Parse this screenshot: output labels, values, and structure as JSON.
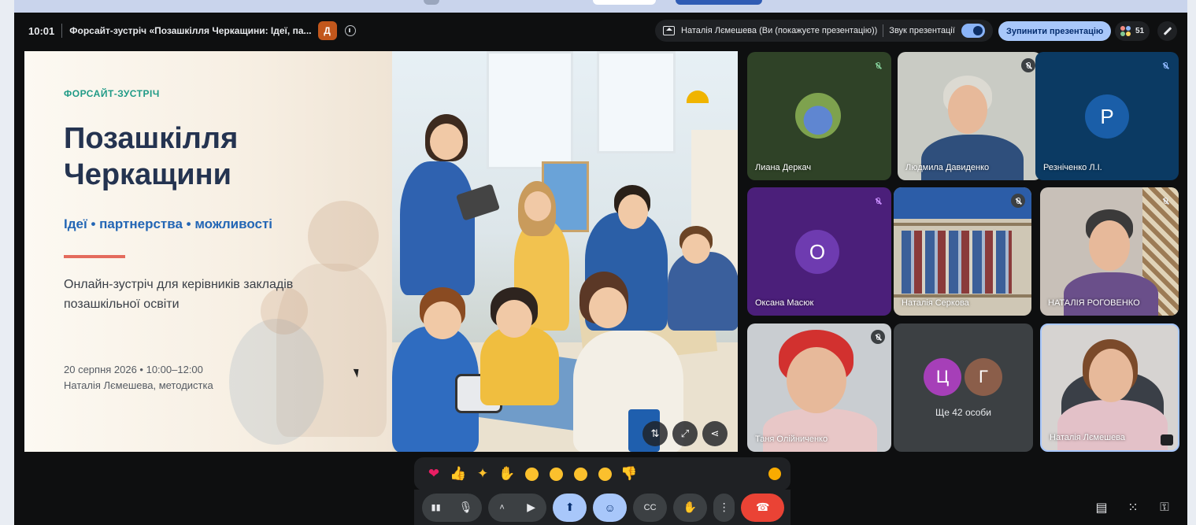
{
  "topbar": {
    "time": "10:01",
    "meeting_title": "Форсайт-зустріч «Позашкілля Черкащини: Ідеї, па...",
    "badge_letter": "Д",
    "presenting_label": "Наталія Лємешева (Ви (покажуєте презентацію))",
    "presentation_sound_label": "Звук презентації",
    "stop_presenting_label": "Зупинити презентацію",
    "participants_count": "51"
  },
  "slide": {
    "kicker": "ФОРСАЙТ-ЗУСТРІЧ",
    "title": "Позашкілля Черкащини",
    "subtitle": "Ідеї • партнерства • можливості",
    "description": "Онлайн-зустріч для керівників закладів позашкільної освіти",
    "date_line": "20 серпня 2026 • 10:00–12:00",
    "author_line": "Наталія Лємешева, методистка"
  },
  "participants": [
    {
      "name": "Лиана Деркач",
      "muted": true,
      "bg": "#2f4227"
    },
    {
      "name": "Людмила Давиденко",
      "muted": true,
      "bg": "#c9cbc4"
    },
    {
      "name": "Резніченко Л.І.",
      "muted": true,
      "bg": "#0b3a63",
      "initial": "Р",
      "avatar_color": "#1a5ea8"
    },
    {
      "name": "Оксана Масюк",
      "muted": true,
      "bg": "#4b1f7a",
      "initial": "О",
      "avatar_color": "#6e3bb0"
    },
    {
      "name": "Наталія Серкова",
      "muted": true,
      "bg": "#cfc7b5"
    },
    {
      "name": "НАТАЛІЯ РОГОВЕНКО",
      "muted": true,
      "bg": "#c8c0b8"
    },
    {
      "name": "Таня Олійниченко",
      "muted": true,
      "bg": "#c9cdd1"
    },
    {
      "name": "Ще 42 особи",
      "initials": [
        "Ц",
        "Г"
      ],
      "avatar_colors": [
        "#a63fb8",
        "#8b5e4a"
      ],
      "bg": "#3c4043"
    },
    {
      "name": "Наталія Лємешева",
      "muted": false,
      "bg": "#d6d3d1"
    }
  ],
  "reactions": [
    "sparkling-heart",
    "thumbs-up",
    "party-popper",
    "clapping-hands",
    "tears-of-joy",
    "surprised-face",
    "crying-face",
    "thinking-face",
    "thumbs-down"
  ],
  "colors": {
    "accent": "#a8c7fa",
    "hangup": "#ea4335",
    "kicker": "#1f9a86",
    "title": "#243350",
    "subtitle": "#2366b5",
    "rule": "#e46b5d"
  }
}
